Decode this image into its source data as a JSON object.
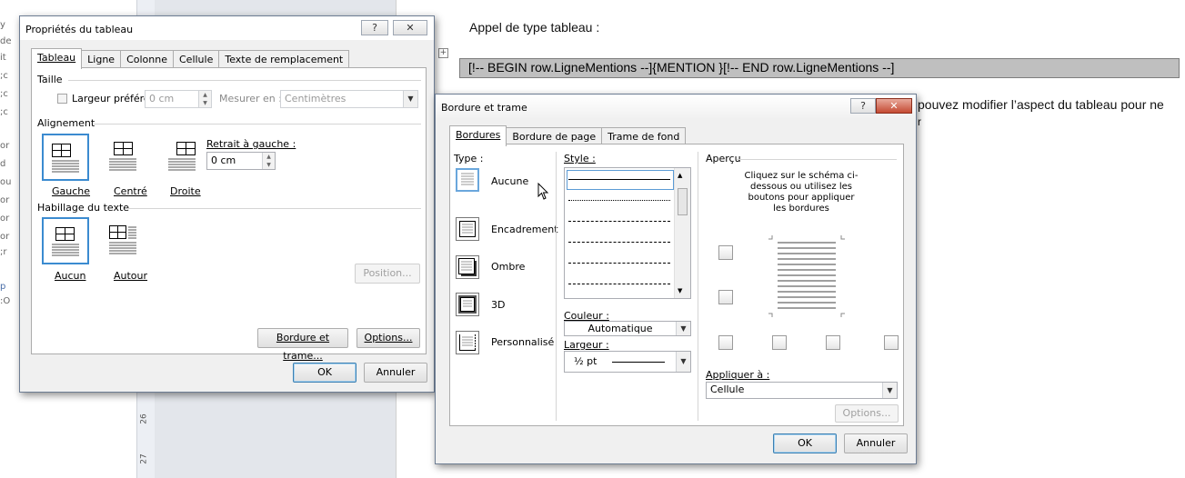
{
  "background": {
    "left_fragments": [
      "y",
      "de",
      "it",
      ";c",
      ";c",
      ";c",
      "or",
      "d",
      "ou",
      "or",
      "or",
      "or",
      ";r",
      "p",
      ":O"
    ],
    "ruler_numbers": [
      "26",
      "27"
    ],
    "doc_heading": "Appel de type tableau :",
    "code_line": "[!-- BEGIN row.LigneMentions --]{MENTION }[!-- END row.LigneMentions --]",
    "doc_body_visible": "pouvez modifier l’aspect du tableau pour ne",
    "doc_body_partial": "r"
  },
  "table_properties_dialog": {
    "title": "Propriétés du tableau",
    "help_glyph": "?",
    "close_glyph": "✕",
    "tabs": [
      "Tableau",
      "Ligne",
      "Colonne",
      "Cellule",
      "Texte de remplacement"
    ],
    "active_tab": "Tableau",
    "size_group": "Taille",
    "preferred_width_label": "Largeur préférée :",
    "preferred_width_checked": false,
    "preferred_width_value": "0 cm",
    "measure_in_label": "Mesurer en :",
    "measure_in_value": "Centimètres",
    "alignment_group": "Alignement",
    "alignment_options": [
      "Gauche",
      "Centré",
      "Droite"
    ],
    "alignment_selected": "Gauche",
    "indent_label": "Retrait à gauche :",
    "indent_value": "0 cm",
    "wrap_group": "Habillage du texte",
    "wrap_options": [
      "Aucun",
      "Autour"
    ],
    "wrap_selected": "Aucun",
    "position_button": "Position...",
    "borders_button": "Bordure et trame...",
    "options_button": "Options...",
    "ok_button": "OK",
    "cancel_button": "Annuler"
  },
  "borders_dialog": {
    "title": "Bordure et trame",
    "help_glyph": "?",
    "close_glyph": "✕",
    "tabs": [
      "Bordures",
      "Bordure de page",
      "Trame de fond"
    ],
    "active_tab": "Bordures",
    "type_label": "Type :",
    "types": [
      "Aucune",
      "Encadrement",
      "Ombre",
      "3D",
      "Personnalisé"
    ],
    "type_selected": "Aucune",
    "style_label": "Style :",
    "color_label": "Couleur :",
    "color_value": "Automatique",
    "width_label": "Largeur :",
    "width_value": "½ pt",
    "preview_label": "Aperçu",
    "preview_hint": "Cliquez sur le schéma ci-dessous ou utilisez les boutons pour appliquer les bordures",
    "apply_to_label": "Appliquer à :",
    "apply_to_value": "Cellule",
    "options_button": "Options...",
    "ok_button": "OK",
    "cancel_button": "Annuler"
  }
}
